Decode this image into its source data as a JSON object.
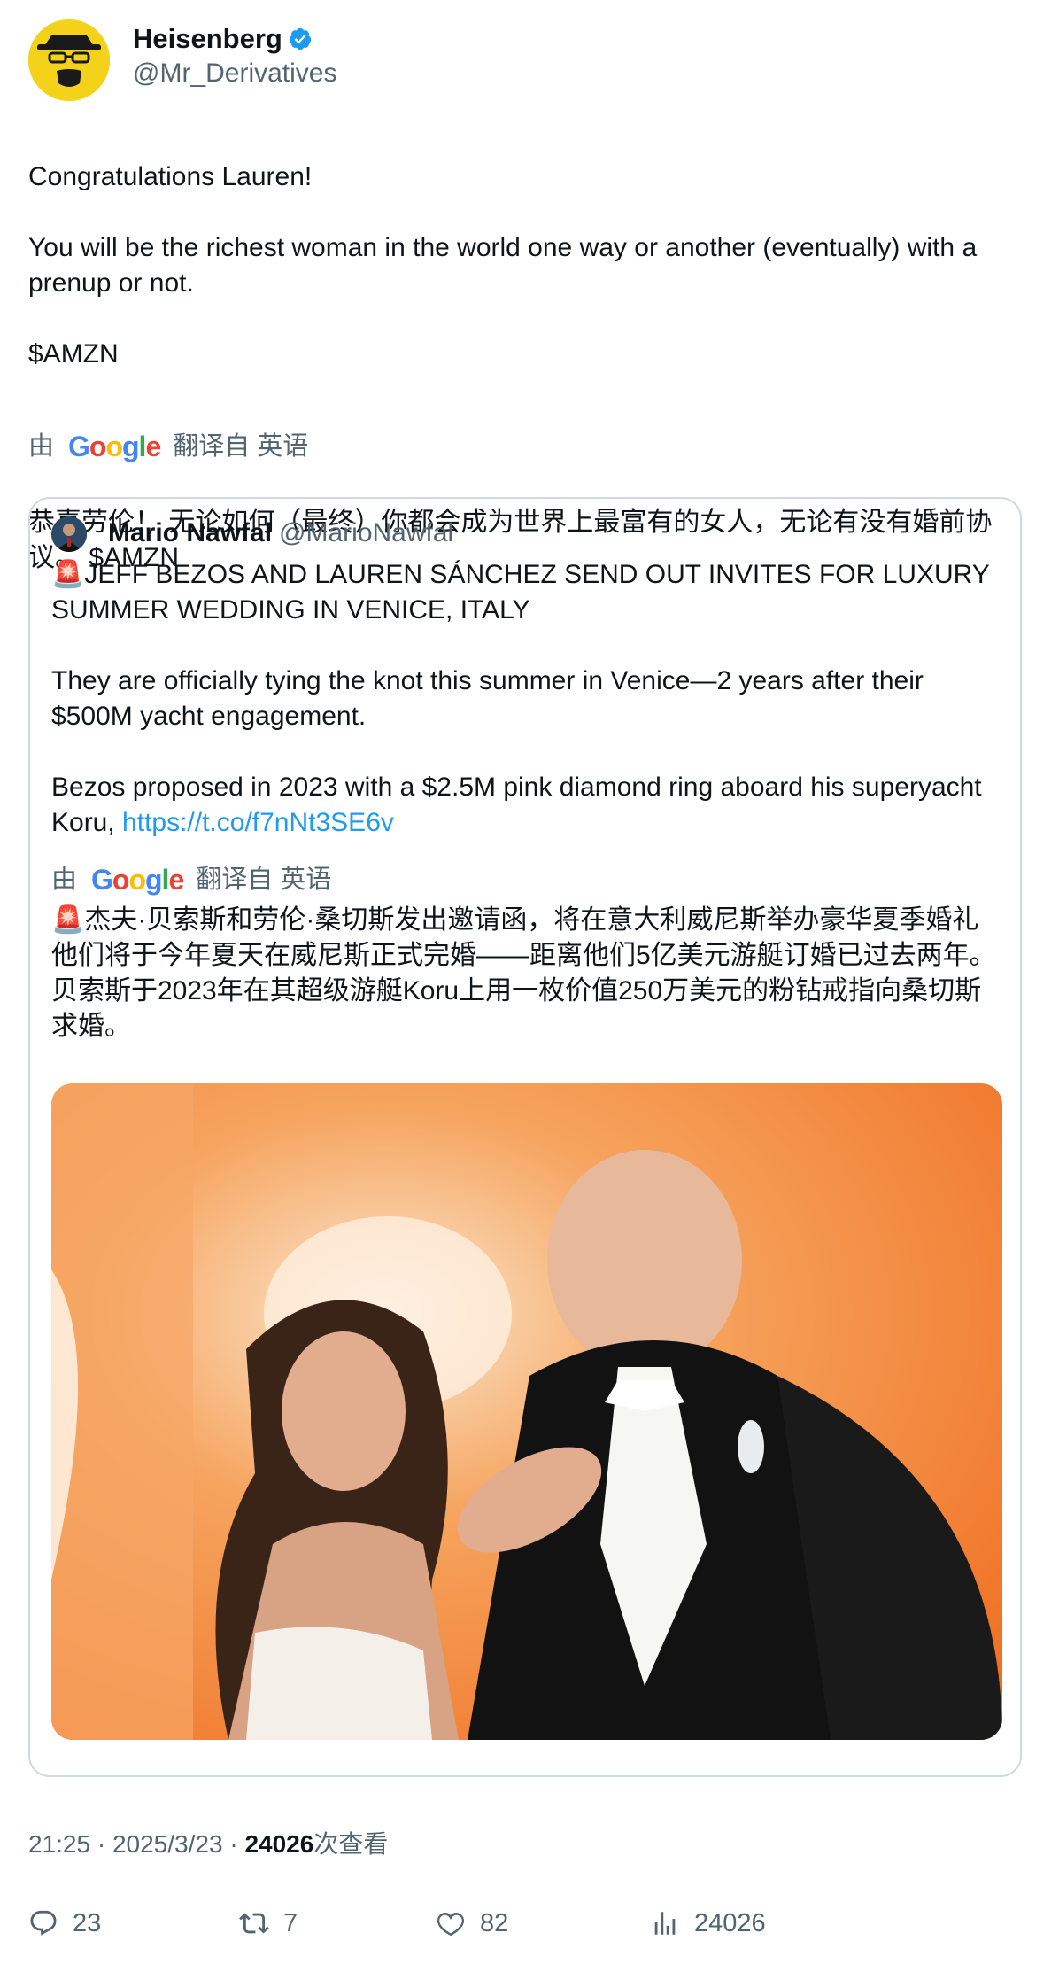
{
  "author": {
    "name": "Heisenberg",
    "handle": "@Mr_Derivatives"
  },
  "tweet": {
    "text": "Congratulations Lauren!\n\nYou will be the richest woman in the world one way or another (eventually) with a prenup or not.\n\n$AMZN",
    "translate_prefix": "由",
    "google_logo": "Google",
    "translate_suffix": "翻译自 英语",
    "translated_text": "恭喜劳伦！ 无论如何（最终）你都会成为世界上最富有的女人，无论有没有婚前协议。 $AMZN"
  },
  "quote": {
    "name": "Mario Nawfal",
    "handle": "@MarioNawfal",
    "siren_icon": "🚨",
    "headline": "JEFF BEZOS AND LAUREN SÁNCHEZ SEND OUT INVITES FOR LUXURY SUMMER WEDDING IN VENICE, ITALY",
    "paragraph2": "They are officially tying the knot this summer in Venice—2 years after their $500M yacht engagement.",
    "paragraph3": "Bezos proposed in 2023 with a $2.5M pink diamond ring aboard his superyacht Koru, ",
    "link": "https://t.co/f7nNt3SE6v",
    "translate_prefix": "由",
    "google_logo": "Google",
    "translate_suffix": "翻译自 英语",
    "translated_text": "杰夫·贝索斯和劳伦·桑切斯发出邀请函，将在意大利威尼斯举办豪华夏季婚礼 他们将于今年夏天在威尼斯正式完婚——距离他们5亿美元游艇订婚已过去两年。 贝索斯于2023年在其超级游艇Koru上用一枚价值250万美元的粉钻戒指向桑切斯求婚。"
  },
  "meta": {
    "time": "21:25",
    "sep": " · ",
    "date": "2025/3/23",
    "views_count": "24026",
    "views_label": "次查看"
  },
  "actions": {
    "replies": "23",
    "reposts": "7",
    "likes": "82",
    "views": "24026"
  },
  "colors": {
    "text": "#0f1419",
    "secondary": "#536471",
    "link": "#1d9bf0",
    "border": "#cfd9de",
    "verified": "#1d9bf0"
  }
}
